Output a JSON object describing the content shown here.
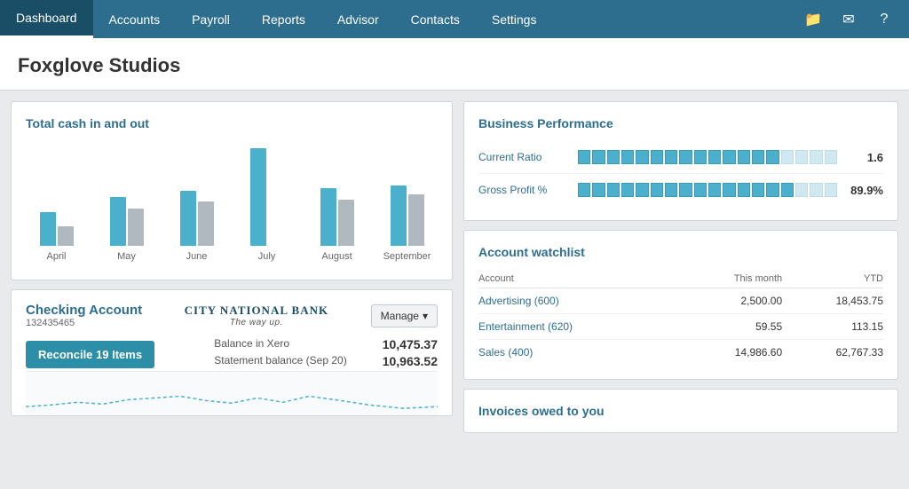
{
  "nav": {
    "items": [
      {
        "label": "Dashboard",
        "active": true
      },
      {
        "label": "Accounts",
        "active": false
      },
      {
        "label": "Payroll",
        "active": false
      },
      {
        "label": "Reports",
        "active": false
      },
      {
        "label": "Advisor",
        "active": false
      },
      {
        "label": "Contacts",
        "active": false
      },
      {
        "label": "Settings",
        "active": false
      }
    ]
  },
  "company": {
    "name": "Foxglove Studios"
  },
  "cash_chart": {
    "title": "Total cash in and out",
    "months": [
      "April",
      "May",
      "June",
      "July",
      "August",
      "September"
    ],
    "blue_bars": [
      38,
      55,
      62,
      110,
      65,
      68
    ],
    "gray_bars": [
      22,
      42,
      50,
      0,
      52,
      58
    ]
  },
  "checking": {
    "title": "Checking Account",
    "account_number": "132435465",
    "bank_name": "CITY NATIONAL BANK",
    "bank_tagline": "The way up.",
    "manage_label": "Manage",
    "reconcile_label": "Reconcile 19 Items",
    "balance_xero_label": "Balance in Xero",
    "balance_xero_value": "10,475.37",
    "statement_label": "Statement balance (Sep 20)",
    "statement_value": "10,963.52"
  },
  "business_performance": {
    "title": "Business Performance",
    "metrics": [
      {
        "label": "Current Ratio",
        "value": "1.6",
        "fill_pct": 78
      },
      {
        "label": "Gross Profit %",
        "value": "89.9%",
        "fill_pct": 85
      }
    ]
  },
  "watchlist": {
    "title": "Account watchlist",
    "col_account": "Account",
    "col_this_month": "This month",
    "col_ytd": "YTD",
    "rows": [
      {
        "account": "Advertising (600)",
        "this_month": "2,500.00",
        "ytd": "18,453.75"
      },
      {
        "account": "Entertainment (620)",
        "this_month": "59.55",
        "ytd": "113.15"
      },
      {
        "account": "Sales (400)",
        "this_month": "14,986.60",
        "ytd": "62,767.33"
      }
    ]
  },
  "invoices": {
    "title": "Invoices owed to you"
  }
}
